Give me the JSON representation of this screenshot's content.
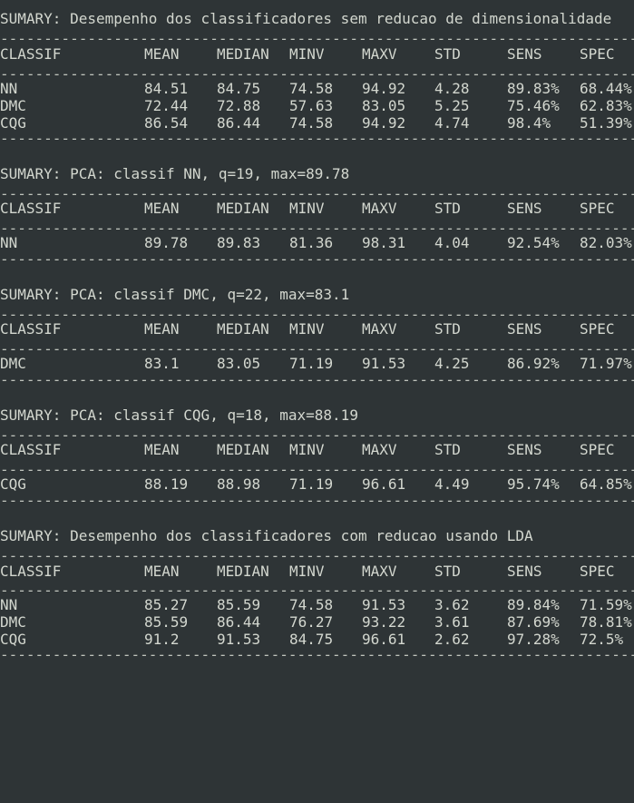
{
  "terminal": {
    "dashes": "------------------------------------------------------------------------------------------------",
    "headers": [
      "CLASSIF",
      "MEAN",
      "MEDIAN",
      "MINV",
      "MAXV",
      "STD",
      "SENS",
      "SPEC"
    ],
    "sections": [
      {
        "title": "SUMARY: Desempenho dos classificadores sem reducao de dimensionalidade",
        "rows": [
          [
            "NN",
            "84.51",
            "84.75",
            "74.58",
            "94.92",
            "4.28",
            "89.83%",
            "68.44%"
          ],
          [
            "DMC",
            "72.44",
            "72.88",
            "57.63",
            "83.05",
            "5.25",
            "75.46%",
            "62.83%"
          ],
          [
            "CQG",
            "86.54",
            "86.44",
            "74.58",
            "94.92",
            "4.74",
            "98.4%",
            "51.39%"
          ]
        ]
      },
      {
        "title": "SUMARY: PCA: classif NN, q=19, max=89.78",
        "rows": [
          [
            "NN",
            "89.78",
            "89.83",
            "81.36",
            "98.31",
            "4.04",
            "92.54%",
            "82.03%"
          ]
        ]
      },
      {
        "title": "SUMARY: PCA: classif DMC, q=22, max=83.1",
        "rows": [
          [
            "DMC",
            "83.1",
            "83.05",
            "71.19",
            "91.53",
            "4.25",
            "86.92%",
            "71.97%"
          ]
        ]
      },
      {
        "title": "SUMARY: PCA: classif CQG, q=18, max=88.19",
        "rows": [
          [
            "CQG",
            "88.19",
            "88.98",
            "71.19",
            "96.61",
            "4.49",
            "95.74%",
            "64.85%"
          ]
        ]
      },
      {
        "title": "SUMARY: Desempenho dos classificadores com reducao usando LDA",
        "rows": [
          [
            "NN",
            "85.27",
            "85.59",
            "74.58",
            "91.53",
            "3.62",
            "89.84%",
            "71.59%"
          ],
          [
            "DMC",
            "85.59",
            "86.44",
            "76.27",
            "93.22",
            "3.61",
            "87.69%",
            "78.81%"
          ],
          [
            "CQG",
            "91.2",
            "91.53",
            "84.75",
            "96.61",
            "2.62",
            "97.28%",
            "72.5%"
          ]
        ]
      }
    ]
  }
}
